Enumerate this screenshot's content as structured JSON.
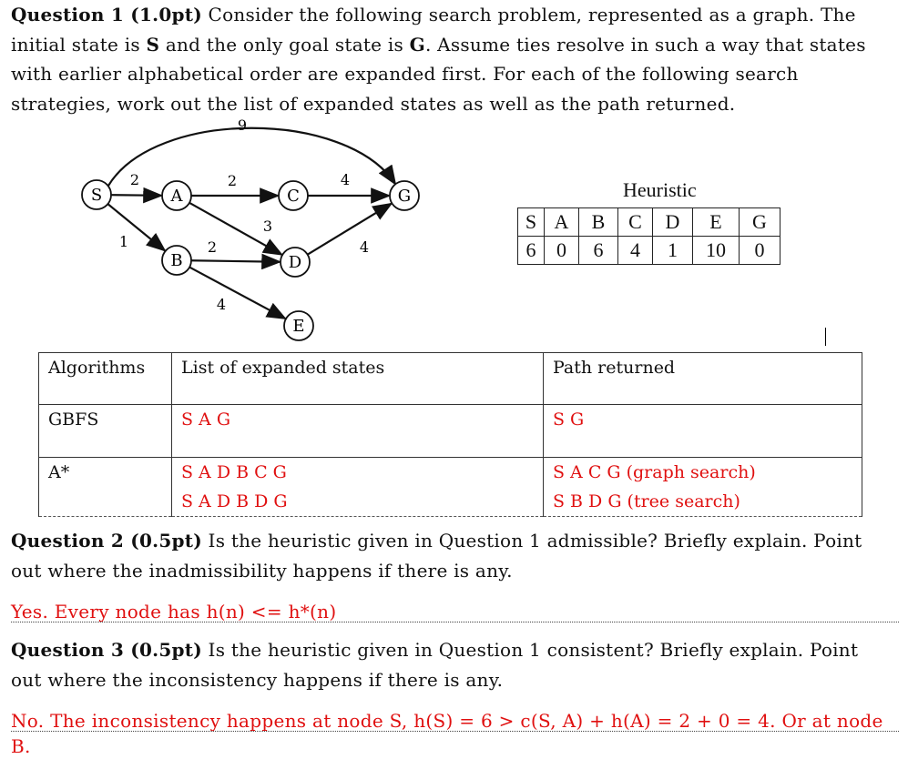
{
  "question1": {
    "label": "Question 1 (1.0pt)",
    "text_a": " Consider the following search problem, represented as a graph. The initial state is ",
    "start": "S",
    "text_b": " and the only goal state is ",
    "goal": "G",
    "text_c": ". Assume ties resolve in such a way that states with earlier alphabetical order are expanded first. For each of the following search strategies, work out the list of expanded states as well as the path returned."
  },
  "graph": {
    "nodes": [
      "S",
      "A",
      "B",
      "C",
      "D",
      "E",
      "G"
    ],
    "edges": [
      {
        "from": "S",
        "to": "A",
        "cost": "2"
      },
      {
        "from": "S",
        "to": "B",
        "cost": "1"
      },
      {
        "from": "S",
        "to": "G",
        "cost": "9"
      },
      {
        "from": "A",
        "to": "C",
        "cost": "2"
      },
      {
        "from": "A",
        "to": "D",
        "cost": "3"
      },
      {
        "from": "B",
        "to": "D",
        "cost": "2"
      },
      {
        "from": "B",
        "to": "E",
        "cost": "4"
      },
      {
        "from": "C",
        "to": "G",
        "cost": "4"
      },
      {
        "from": "D",
        "to": "G",
        "cost": "4"
      }
    ]
  },
  "heuristic": {
    "title": "Heuristic",
    "states": [
      "S",
      "A",
      "B",
      "C",
      "D",
      "E",
      "G"
    ],
    "values": [
      "6",
      "0",
      "6",
      "4",
      "1",
      "10",
      "0"
    ]
  },
  "results_table": {
    "headers": [
      "Algorithms",
      "List of expanded states",
      "Path returned"
    ],
    "rows": [
      {
        "algorithm": "GBFS",
        "expanded": [
          "S A G"
        ],
        "path": [
          "S G"
        ]
      },
      {
        "algorithm": "A*",
        "expanded": [
          "S A D B C G",
          "S A D B D G"
        ],
        "path": [
          "S A C G (graph search)",
          "S B D G (tree search)"
        ]
      }
    ]
  },
  "question2": {
    "label": "Question 2 (0.5pt)",
    "text": " Is the heuristic given in Question 1 admissible? Briefly explain. Point out where the inadmissibility happens if there is any.",
    "answer": "Yes. Every node has h(n) <= h*(n)"
  },
  "question3": {
    "label": "Question 3 (0.5pt)",
    "text": " Is the heuristic given in Question 1 consistent? Briefly explain. Point out where the inconsistency happens if there is any.",
    "answer": "No. The inconsistency happens at node S, h(S) = 6 > c(S, A) + h(A) = 2 + 0 = 4. Or at node B."
  },
  "colors": {
    "answer": "#e01010",
    "text": "#111111"
  }
}
